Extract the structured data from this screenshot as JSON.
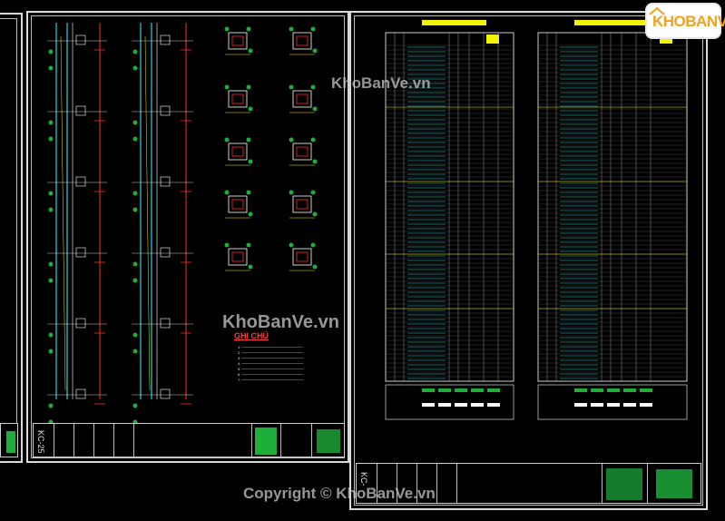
{
  "watermarks": {
    "top": "KhoBanVe.vn",
    "middle": "KhoBanVe.vn",
    "copyright": "Copyright © KhoBanVe.vn"
  },
  "logo": {
    "text": "KHOBANVE",
    "brand_color": "#f0a21f"
  },
  "notes": {
    "title": "GHI CHÚ",
    "lines": [
      "1.",
      "2.",
      "3.",
      "4.",
      "5.",
      "6.",
      "7."
    ]
  },
  "sheets": {
    "left_sheet_code": "KC-25",
    "right_sheet_code": "KC-"
  },
  "colors": {
    "background": "#000000",
    "frame": "#d9d9d9",
    "cyan": "#27d3e0",
    "red": "#ff2a2a",
    "green": "#1fae3a",
    "yellow": "#f3f300"
  }
}
